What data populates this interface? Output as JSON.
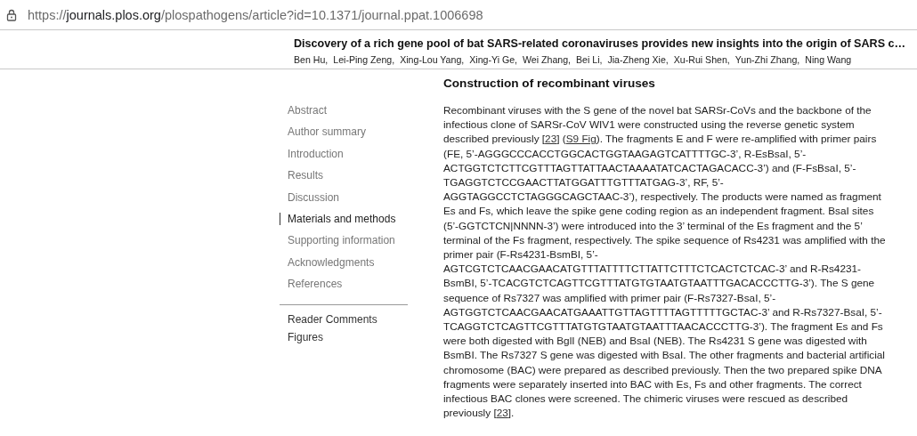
{
  "address_bar": {
    "scheme": "https://",
    "host": "journals.plos.org",
    "path": "/plospathogens/article?id=10.1371/journal.ppat.1006698"
  },
  "article": {
    "title": "Discovery of a rich gene pool of bat SARS-related coronaviruses provides new insights into the origin of SARS c…",
    "authors": [
      "Ben Hu,",
      "Lei-Ping Zeng,",
      "Xing-Lou Yang,",
      "Xing-Yi Ge,",
      "Wei Zhang,",
      "Bei Li,",
      "Jia-Zheng Xie,",
      "Xu-Rui Shen,",
      "Yun-Zhi Zhang,",
      "Ning Wang"
    ]
  },
  "sidebar": {
    "sections": [
      {
        "label": "Abstract",
        "selected": false
      },
      {
        "label": "Author summary",
        "selected": false
      },
      {
        "label": "Introduction",
        "selected": false
      },
      {
        "label": "Results",
        "selected": false
      },
      {
        "label": "Discussion",
        "selected": false
      },
      {
        "label": "Materials and methods",
        "selected": true
      },
      {
        "label": "Supporting information",
        "selected": false
      },
      {
        "label": "Acknowledgments",
        "selected": false
      },
      {
        "label": "References",
        "selected": false
      }
    ],
    "extras": [
      "Reader Comments",
      "Figures"
    ]
  },
  "content": {
    "heading": "Construction of recombinant viruses",
    "paragraph": [
      {
        "kind": "text",
        "text": "Recombinant viruses with the S gene of the novel bat SARSr-CoVs and the backbone of the infectious clone of SARSr-CoV WIV1 were constructed using the reverse genetic system described previously ["
      },
      {
        "kind": "link",
        "text": "23"
      },
      {
        "kind": "text",
        "text": "] ("
      },
      {
        "kind": "link",
        "text": "S9 Fig"
      },
      {
        "kind": "text",
        "text": "). The fragments E and F were re-amplified with primer pairs (FE, 5’-AGGGCCCACCTGGCACTGGTAAGAGTCATTTTGC-3’, R-EsBsaI, 5’-ACTGGTCTCTTCGTTTAGTTATTAACTAAAATATCACTAGACACC-3’) and (F-FsBsaI, 5’-TGAGGTCTCCGAACTTATGGATTTGTTTATGAG-3’, RF, 5’-AGGTAGGCCTCTAGGGCAGCTAAC-3’), respectively. The products were named as fragment Es and Fs, which leave the spike gene coding region as an independent fragment. BsaI sites (5’-GGTCTCN|NNNN-3’) were introduced into the 3’ terminal of the Es fragment and the 5’ terminal of the Fs fragment, respectively. The spike sequence of Rs4231 was amplified with the primer pair (F-Rs4231-BsmBI, 5’-AGTCGTCTCAACGAACATGTTTATTTTCTTATTCTTTCTCACTCTCAC-3’ and R-Rs4231-BsmBI, 5’-TCACGTCTCAGTTCGTTTATGTGTAATGTAATTTGACACCCTTG-3’). The S gene sequence of Rs7327 was amplified with primer pair (F-Rs7327-BsaI, 5’-AGTGGTCTCAACGAACATGAAATTGTTAGTTTTAGTTTTTGCTAC-3’ and R-Rs7327-BsaI, 5’-TCAGGTCTCAGTTCGTTTATGTGTAATGTAATTTAACACCCTTG-3’). The fragment Es and Fs were both digested with BglI (NEB) and BsaI (NEB). The Rs4231 S gene was digested with BsmBI. The Rs7327 S gene was digested with BsaI. The other fragments and bacterial artificial chromosome (BAC) were prepared as described previously. Then the two prepared spike DNA fragments were separately inserted into BAC with Es, Fs and other fragments. The correct infectious BAC clones were screened. The chimeric viruses were rescued as described previously ["
      },
      {
        "kind": "link",
        "text": "23"
      },
      {
        "kind": "text",
        "text": "]."
      }
    ]
  }
}
